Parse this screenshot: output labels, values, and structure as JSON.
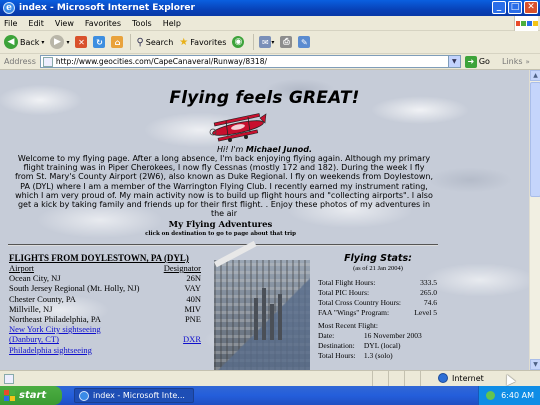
{
  "window": {
    "title": "index - Microsoft Internet Explorer",
    "minimize": "_",
    "maximize": "□",
    "close": "✕"
  },
  "menu": [
    "File",
    "Edit",
    "View",
    "Favorites",
    "Tools",
    "Help"
  ],
  "toolbar": {
    "back": "Back",
    "search": "Search",
    "favorites": "Favorites"
  },
  "address": {
    "label": "Address",
    "url": "http://www.geocities.com/CapeCanaveral/Runway/8318/",
    "go": "Go",
    "links": "Links"
  },
  "page": {
    "heading": "Flying feels GREAT!",
    "greeting": "Hi! I'm",
    "name": "Michael Junod.",
    "intro": "Welcome to my flying page.  After a long absence, I'm back enjoying flying again.   Although my primary flight training was in Piper Cherokees, I now fly Cessnas (mostly 172 and 182).  During the week I fly from St. Mary's County Airport (2W6), also known as Duke Regional.  I fly on weekends from Doylestown, PA (DYL) where I am a member  of  the Warrington Flying Club.  I recently earned my instrument rating, which I am very proud of.  My main activity now is to build up flight hours and \"collecting airports\".  I also get a kick by taking family and friends up for their first flight. .   Enjoy these photos of my adventures in the air",
    "photos_heading": "My Flying Adventures",
    "photos_sub": "click on destination to go to page about that trip"
  },
  "flights": {
    "title": "FLIGHTS FROM DOYLESTOWN, PA  (DYL)",
    "col_airport": "Airport",
    "col_designator": "Designator",
    "rows": [
      {
        "airport": "Ocean City, NJ",
        "designator": "26N"
      },
      {
        "airport": "South Jersey Regional (Mt. Holly, NJ)",
        "designator": "VAY"
      },
      {
        "airport": "Chester County, PA",
        "designator": "40N"
      },
      {
        "airport": "Millville, NJ",
        "designator": "MIV"
      },
      {
        "airport": "Northeast Philadelphia, PA",
        "designator": "PNE"
      }
    ],
    "links": [
      {
        "line1": "New York City sightseeing",
        "line2": "(Danbury, CT)",
        "designator": "DXR"
      },
      {
        "line1": "Philadelphia sightseeing",
        "line2": "",
        "designator": ""
      }
    ]
  },
  "stats": {
    "title": "Flying Stats:",
    "as_of": "(as of 21 Jan 2004)",
    "rows": [
      {
        "label": "Total Flight Hours:",
        "value": "333.5"
      },
      {
        "label": "Total PIC Hours:",
        "value": "265.0"
      },
      {
        "label": "Total Cross Country Hours:",
        "value": "74.6"
      },
      {
        "label": "FAA \"Wings\" Program:",
        "value": "Level 5"
      }
    ],
    "recent_label": "Most Recent Flight:",
    "recent": [
      {
        "key": "Date:",
        "value": "16 November 2003"
      },
      {
        "key": "Destination:",
        "value": "DYL (local)"
      },
      {
        "key": "Total Hours:",
        "value": "1.3 (solo)"
      }
    ]
  },
  "status": {
    "zone": "Internet"
  },
  "taskbar": {
    "start": "start",
    "task": "index - Microsoft Inte...",
    "clock": "6:40 AM"
  }
}
